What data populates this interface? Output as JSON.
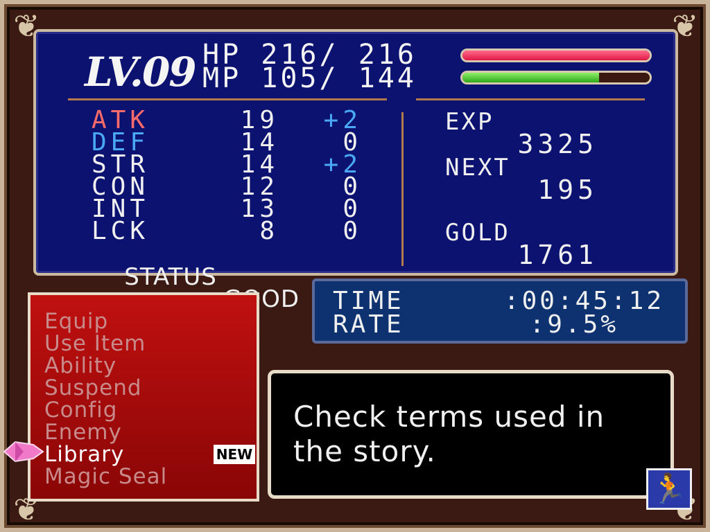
{
  "level": "LV.09",
  "hp": {
    "label": "HP",
    "current": "216",
    "max": "216",
    "fraction": 1.0
  },
  "mp": {
    "label": "MP",
    "current": "105",
    "max": "144",
    "fraction": 0.73
  },
  "stats": [
    {
      "name": "ATK",
      "value": "19",
      "bonus": "+2",
      "color": "#ff6a6a"
    },
    {
      "name": "DEF",
      "value": "14",
      "bonus": "0",
      "color": "#4aa8f4"
    },
    {
      "name": "STR",
      "value": "14",
      "bonus": "+2",
      "color": "#f0f0f0"
    },
    {
      "name": "CON",
      "value": "12",
      "bonus": "0",
      "color": "#f0f0f0"
    },
    {
      "name": "INT",
      "value": "13",
      "bonus": "0",
      "color": "#f0f0f0"
    },
    {
      "name": "LCK",
      "value": "8",
      "bonus": "0",
      "color": "#f0f0f0"
    }
  ],
  "status": {
    "label": "STATUS",
    "value": "GOOD"
  },
  "exp": {
    "label": "EXP",
    "value": "3325"
  },
  "next": {
    "label": "NEXT",
    "value": "195"
  },
  "gold": {
    "label": "GOLD",
    "value": "1761"
  },
  "time": {
    "label": "TIME",
    "value": ":00:45:12"
  },
  "rate": {
    "label": "RATE",
    "value": ":9.5%"
  },
  "menu": [
    "Equip",
    "Use Item",
    "Ability",
    "Suspend",
    "Config",
    "Enemy",
    "Library",
    "Magic Seal"
  ],
  "menu_selected": "Library",
  "new_badge": "NEW",
  "description": "Check terms used in the story.",
  "icons": {
    "cursor": "pink-gem-cursor-icon",
    "return": "running-man-return-icon"
  }
}
